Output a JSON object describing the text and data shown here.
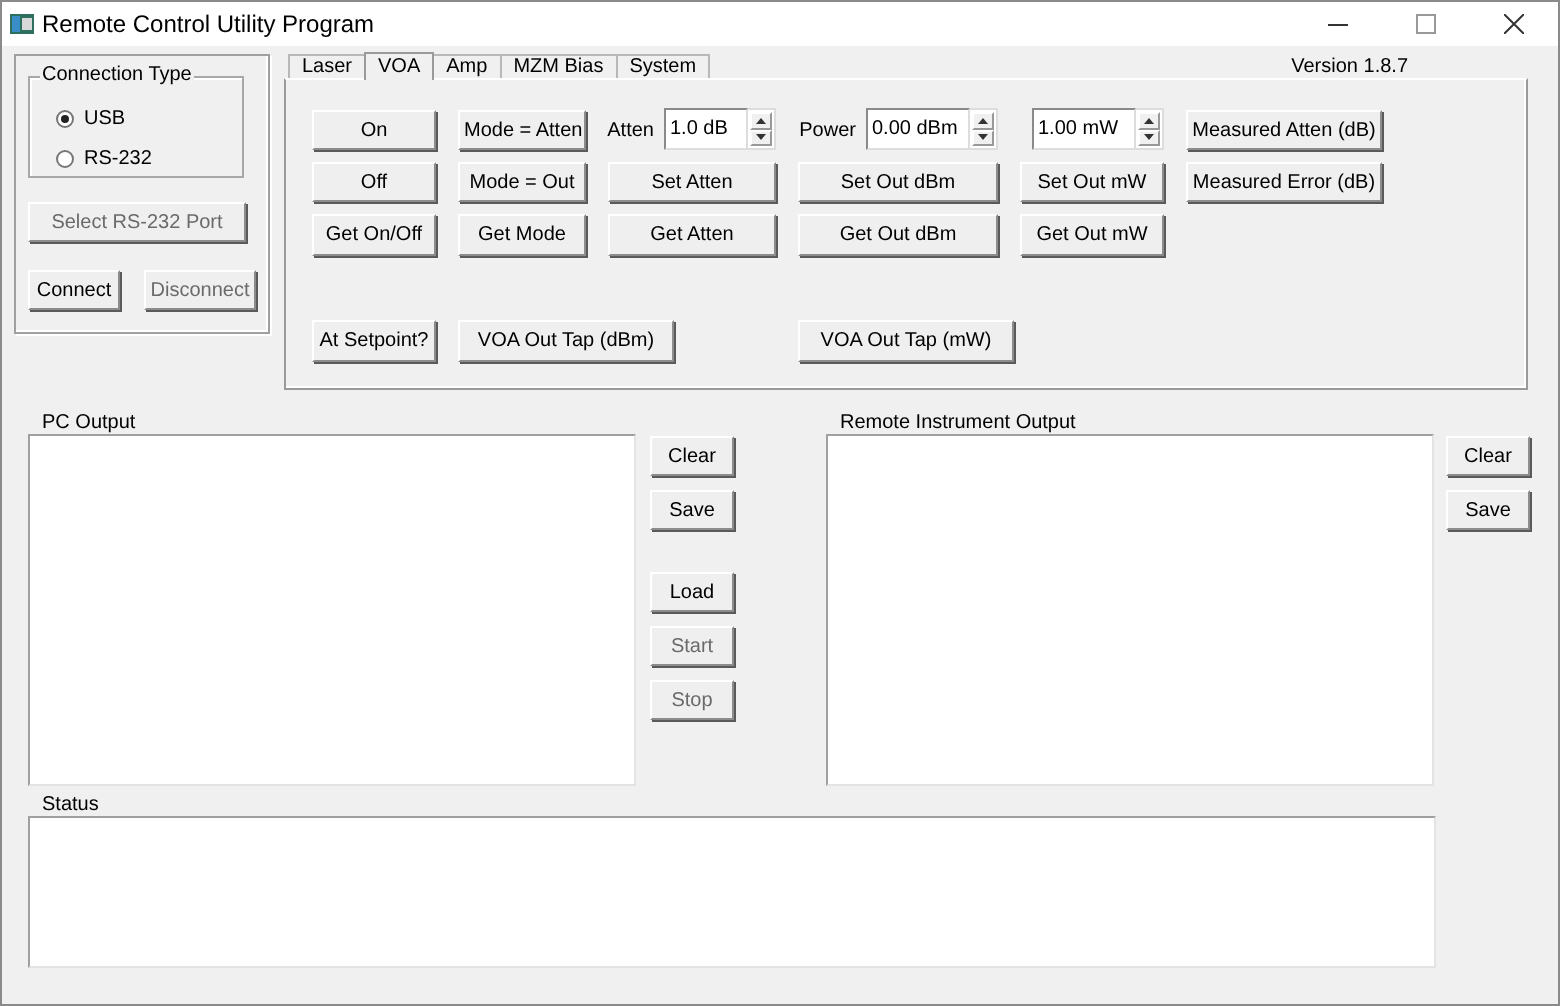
{
  "window": {
    "title": "Remote Control Utility Program"
  },
  "connection": {
    "title": "Connection Type",
    "options": [
      {
        "label": "USB",
        "selected": true
      },
      {
        "label": "RS-232",
        "selected": false
      }
    ],
    "buttons": [
      {
        "label": "Select RS-232 Port",
        "disabled": true
      },
      {
        "label": "Connect",
        "disabled": false
      },
      {
        "label": "Disconnect",
        "disabled": true
      }
    ]
  },
  "tabs": [
    {
      "label": "Laser",
      "selected": false
    },
    {
      "label": "VOA",
      "selected": true
    },
    {
      "label": "Amp",
      "selected": false
    },
    {
      "label": "MZM Bias",
      "selected": false
    },
    {
      "label": "System",
      "selected": false
    }
  ],
  "version": "Version 1.8.7",
  "voa_rows": [
    [
      {
        "kind": "button",
        "label": "On"
      },
      {
        "kind": "button",
        "label": "Mode = Atten"
      },
      {
        "kind": "spinner",
        "label": "Atten",
        "value": "1.0 dB"
      },
      {
        "kind": "spinner",
        "label": "Power",
        "value": "0.00 dBm"
      },
      {
        "kind": "spinner",
        "value": "1.00 mW"
      },
      {
        "kind": "button",
        "label": "Measured Atten (dB)"
      }
    ],
    [
      {
        "kind": "button",
        "label": "Off"
      },
      {
        "kind": "button",
        "label": "Mode = Out"
      },
      {
        "kind": "button",
        "label": "Set Atten"
      },
      {
        "kind": "button",
        "label": "Set Out dBm"
      },
      {
        "kind": "button",
        "label": "Set Out mW"
      },
      {
        "kind": "button",
        "label": "Measured Error (dB)"
      }
    ],
    [
      {
        "kind": "button",
        "label": "Get On/Off"
      },
      {
        "kind": "button",
        "label": "Get Mode"
      },
      {
        "kind": "button",
        "label": "Get Atten"
      },
      {
        "kind": "button",
        "label": "Get Out dBm"
      },
      {
        "kind": "button",
        "label": "Get Out mW"
      }
    ],
    [
      {
        "kind": "button",
        "label": "At Setpoint?"
      },
      {
        "kind": "button",
        "label": "VOA Out Tap (dBm)"
      },
      {
        "kind": "button",
        "label": "VOA Out Tap (mW)"
      }
    ]
  ],
  "pc_output": {
    "label": "PC Output",
    "buttons": [
      {
        "label": "Clear",
        "disabled": false
      },
      {
        "label": "Save",
        "disabled": false
      },
      {
        "label": "Load",
        "disabled": false
      },
      {
        "label": "Start",
        "disabled": true
      },
      {
        "label": "Stop",
        "disabled": true
      }
    ]
  },
  "remote_output": {
    "label": "Remote Instrument Output",
    "buttons": [
      {
        "label": "Clear",
        "disabled": false
      },
      {
        "label": "Save",
        "disabled": false
      }
    ]
  },
  "status": {
    "label": "Status"
  }
}
